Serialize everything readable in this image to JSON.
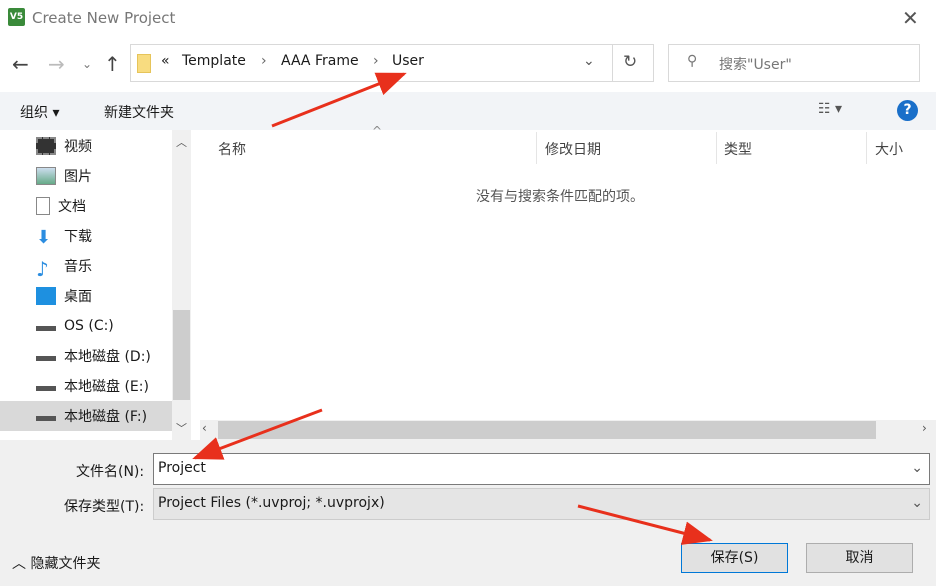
{
  "window": {
    "title": "Create New Project",
    "icon_text": "V5"
  },
  "address": {
    "overflow": "«",
    "crumbs": [
      "Template",
      "AAA Frame",
      "User"
    ]
  },
  "search": {
    "placeholder": "搜索\"User\""
  },
  "toolbar": {
    "organize": "组织 ▾",
    "new_folder": "新建文件夹",
    "help": "?"
  },
  "sidebar": {
    "items": [
      {
        "label": "视频",
        "icon": "video-icon"
      },
      {
        "label": "图片",
        "icon": "pictures-icon"
      },
      {
        "label": "文档",
        "icon": "documents-icon"
      },
      {
        "label": "下载",
        "icon": "download-icon"
      },
      {
        "label": "音乐",
        "icon": "music-icon"
      },
      {
        "label": "桌面",
        "icon": "desktop-icon"
      },
      {
        "label": "OS (C:)",
        "icon": "drive-icon"
      },
      {
        "label": "本地磁盘 (D:)",
        "icon": "drive-icon"
      },
      {
        "label": "本地磁盘 (E:)",
        "icon": "drive-icon"
      },
      {
        "label": "本地磁盘 (F:)",
        "icon": "drive-icon",
        "selected": true
      }
    ]
  },
  "columns": [
    "名称",
    "修改日期",
    "类型",
    "大小"
  ],
  "empty_message": "没有与搜索条件匹配的项。",
  "form": {
    "filename_label": "文件名(N):",
    "filename_value": "Project",
    "type_label": "保存类型(T):",
    "type_value": "Project Files (*.uvproj; *.uvprojx)"
  },
  "footer": {
    "hide_folders": "隐藏文件夹",
    "save": "保存(S)",
    "cancel": "取消"
  },
  "colors": {
    "annotation_arrow": "#e8301c",
    "selection": "#d9d9d9",
    "help": "#1a6fc9"
  }
}
